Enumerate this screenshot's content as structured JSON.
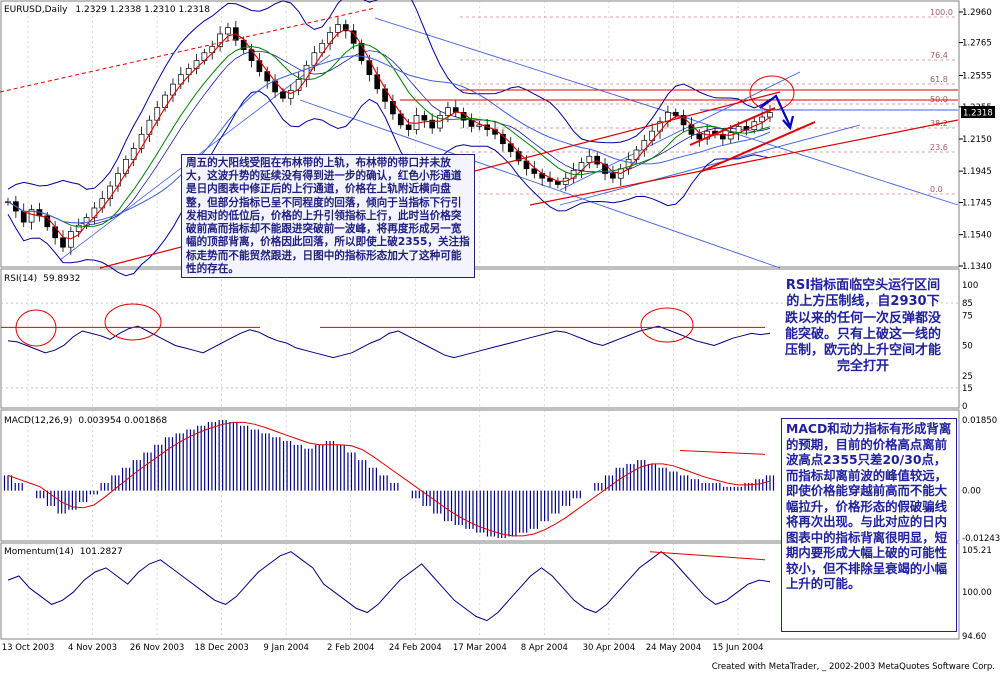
{
  "window": {
    "symbol": "EURUSD,Daily",
    "ohlc": "1.2329 1.2338 1.2310 1.2318",
    "footer": "Created with MetaTrader, _ 2002-2003 MetaQuotes Software Corp."
  },
  "colors": {
    "candle": "#000000",
    "bollinger": "#0000a0",
    "ma_red": "#e00000",
    "ma_green": "#008000",
    "ma_blue": "#4060e0",
    "trendline": "#e00000",
    "channel": "#4060e0",
    "fib": "#e08080",
    "note_text": "#2020a0",
    "grid": "#c0c0c0"
  },
  "main": {
    "price_labels": [
      "1.2960",
      "1.2765",
      "1.2555",
      "1.2355",
      "1.2150",
      "1.1945",
      "1.1745",
      "1.1540",
      "1.1340"
    ],
    "current_price": "1.2318",
    "fib_levels": [
      "100.0",
      "76.4",
      "61.8",
      "50.0",
      "38.2",
      "23.6",
      "0.0"
    ]
  },
  "rsi": {
    "title": "RSI(14)",
    "value": "59.8932",
    "levels": [
      "100",
      "85",
      "75",
      "50",
      "25",
      "15",
      "0"
    ]
  },
  "macd": {
    "title": "MACD(12,26,9)",
    "values": "0.003954  0.001868",
    "levels": [
      "0.01850",
      "0.00",
      "-0.01243"
    ]
  },
  "momentum": {
    "title": "Momentum(14)",
    "value": "101.2827",
    "levels": [
      "105.21",
      "100.00",
      "94.60"
    ]
  },
  "x_axis": [
    "13 Oct 2003",
    "4 Nov 2003",
    "26 Nov 2003",
    "18 Dec 2003",
    "9 Jan 2004",
    "2 Feb 2004",
    "24 Feb 2004",
    "17 Mar 2004",
    "8 Apr 2004",
    "30 Apr 2004",
    "24 May 2004",
    "15 Jun 2004"
  ],
  "notes": {
    "main": "周五的大阳线受阻在布林带的上轨，布林带的带口并未放大，这波升势的延续没有得到进一步的确认，红色小形通道是日内图表中修正后的上行通道，价格在上轨附近横向盘整，但部分指标已呈不同程度的回落，倾向于当指标下行引发相对的低位后，价格的上升引领指标上行，此时当价格突破前高而指标却不能跟进突破前一波峰，将再度形成另一宽幅的顶部背离，价格因此回落，所以即使上破2355，关注指标走势而不能贸然跟进，日图中的指标形态加大了这种可能性的存在。",
    "rsi": "RSI指标面临空头运行区间的上方压制线，自2930下跌以来的任何一次反弹都没能突破。只有上破这一线的压制，欧元的上升空间才能完全打开",
    "macd": "MACD和动力指标有形成背离的预期，目前的价格高点离前波高点2355只差20/30点，而指标却离前波的峰值较远，即使价格能穿越前高而不能大幅拉升，价格形态的假破骗线将再次出现。与此对应的日内图表中的指标背离很明显，短期内要形成大幅上破的可能性较小，但不排除呈衰竭的小幅上升的可能。"
  },
  "chart_data": {
    "type": "candlestick",
    "title": "EURUSD,Daily",
    "x_ticks": [
      "13 Oct 2003",
      "4 Nov 2003",
      "26 Nov 2003",
      "18 Dec 2003",
      "9 Jan 2004",
      "2 Feb 2004",
      "24 Feb 2004",
      "17 Mar 2004",
      "8 Apr 2004",
      "30 Apr 2004",
      "24 May 2004",
      "15 Jun 2004"
    ],
    "y_range": [
      1.134,
      1.296
    ],
    "price_series": [
      1.175,
      1.169,
      1.162,
      1.17,
      1.166,
      1.159,
      1.152,
      1.146,
      1.156,
      1.16,
      1.165,
      1.171,
      1.177,
      1.185,
      1.193,
      1.202,
      1.209,
      1.218,
      1.227,
      1.235,
      1.243,
      1.25,
      1.256,
      1.26,
      1.265,
      1.27,
      1.274,
      1.282,
      1.286,
      1.278,
      1.272,
      1.265,
      1.258,
      1.252,
      1.245,
      1.241,
      1.246,
      1.253,
      1.262,
      1.27,
      1.276,
      1.283,
      1.288,
      1.284,
      1.276,
      1.265,
      1.256,
      1.247,
      1.239,
      1.231,
      1.224,
      1.221,
      1.23,
      1.227,
      1.222,
      1.23,
      1.235,
      1.232,
      1.227,
      1.223,
      1.224,
      1.221,
      1.218,
      1.212,
      1.207,
      1.201,
      1.196,
      1.193,
      1.19,
      1.188,
      1.186,
      1.19,
      1.195,
      1.2,
      1.204,
      1.199,
      1.193,
      1.19,
      1.196,
      1.202,
      1.208,
      1.214,
      1.22,
      1.226,
      1.232,
      1.23,
      1.224,
      1.218,
      1.215,
      1.22,
      1.218,
      1.215,
      1.219,
      1.223,
      1.221,
      1.226,
      1.229,
      1.2318
    ],
    "rsi_series": [
      54,
      53,
      50,
      47,
      44,
      46,
      50,
      57,
      62,
      60,
      58,
      55,
      60,
      64,
      66,
      62,
      58,
      54,
      50,
      48,
      46,
      44,
      48,
      52,
      56,
      60,
      63,
      61,
      57,
      54,
      52,
      48,
      46,
      44,
      42,
      40,
      42,
      44,
      48,
      52,
      55,
      60,
      62,
      58,
      54,
      50,
      46,
      42,
      40,
      42,
      44,
      46,
      48,
      50,
      52,
      54,
      56,
      58,
      60,
      62,
      61,
      58,
      55,
      52,
      50,
      53,
      56,
      59,
      62,
      64,
      66,
      63,
      60,
      57,
      54,
      52,
      50,
      53,
      56,
      58,
      60,
      59,
      60
    ],
    "macd_histogram": [
      0.004,
      0.002,
      0.0,
      -0.002,
      -0.004,
      -0.006,
      -0.005,
      -0.003,
      -0.001,
      0.002,
      0.004,
      0.006,
      0.008,
      0.01,
      0.012,
      0.014,
      0.015,
      0.016,
      0.017,
      0.018,
      0.0185,
      0.018,
      0.017,
      0.016,
      0.015,
      0.014,
      0.013,
      0.012,
      0.011,
      0.012,
      0.013,
      0.012,
      0.01,
      0.008,
      0.006,
      0.004,
      0.002,
      0.0,
      -0.002,
      -0.004,
      -0.006,
      -0.008,
      -0.009,
      -0.01,
      -0.011,
      -0.012,
      -0.0124,
      -0.012,
      -0.011,
      -0.01,
      -0.008,
      -0.006,
      -0.004,
      -0.002,
      0.0,
      0.002,
      0.004,
      0.006,
      0.007,
      0.008,
      0.007,
      0.006,
      0.005,
      0.004,
      0.003,
      0.002,
      0.002,
      0.001,
      0.001,
      0.002,
      0.003,
      0.004
    ],
    "momentum_series": [
      101.5,
      102.0,
      100.5,
      99.5,
      98.5,
      99.0,
      100.0,
      101.5,
      102.5,
      103.0,
      102.0,
      101.0,
      102.5,
      103.5,
      104.0,
      103.0,
      102.0,
      101.0,
      100.0,
      99.0,
      98.5,
      99.5,
      101.0,
      102.5,
      103.5,
      104.5,
      105.0,
      104.0,
      103.0,
      101.0,
      100.0,
      99.0,
      98.0,
      97.5,
      98.5,
      100.0,
      101.5,
      102.5,
      103.5,
      102.0,
      100.5,
      99.0,
      98.0,
      97.0,
      96.5,
      97.5,
      99.0,
      100.5,
      102.0,
      103.0,
      102.0,
      100.5,
      99.0,
      98.0,
      97.5,
      98.5,
      100.0,
      101.5,
      103.0,
      104.0,
      105.0,
      104.0,
      102.5,
      101.0,
      99.5,
      98.5,
      99.0,
      100.0,
      101.0,
      101.5,
      101.2827
    ]
  }
}
